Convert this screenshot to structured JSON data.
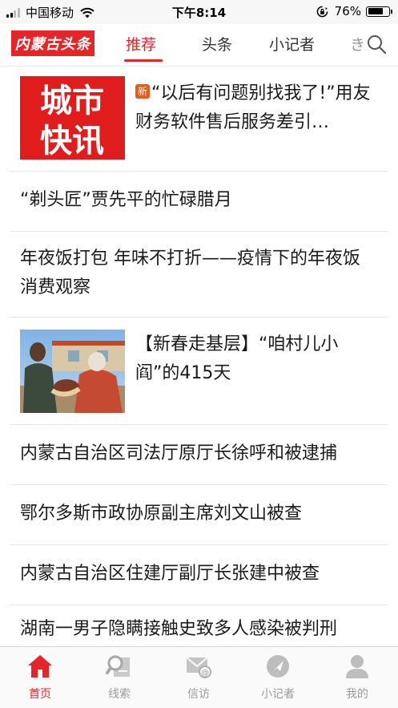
{
  "status_bar": {
    "carrier": "中国移动",
    "time": "下午8:14",
    "battery_percent": "76%",
    "battery_level": 0.76
  },
  "nav": {
    "logo_text": "内蒙古头条",
    "tabs": [
      {
        "label": "推荐",
        "active": true
      },
      {
        "label": "头条",
        "active": false
      },
      {
        "label": "小记者",
        "active": false
      },
      {
        "label": "き",
        "active": false
      }
    ],
    "accent_color": "#e4262a"
  },
  "articles": [
    {
      "badge": "新",
      "title": "“以后有问题别找我了!”用友财务软件售后服务差引…",
      "thumbnail_text": [
        "城市",
        "快讯"
      ]
    },
    {
      "title": "“剃头匠”贾先平的忙碌腊月"
    },
    {
      "title": "年夜饭打包 年味不打折——疫情下的年夜饭消费观察"
    },
    {
      "title": "【新春走基层】“咱村儿小阎”的415天"
    },
    {
      "title": "内蒙古自治区司法厅原厅长徐呼和被逮捕"
    },
    {
      "title": "鄂尔多斯市政协原副主席刘文山被查"
    },
    {
      "title": "内蒙古自治区住建厅副厅长张建中被查"
    },
    {
      "title": "湖南一男子隐瞒接触史致多人感染被判刑"
    }
  ],
  "tab_bar": {
    "items": [
      {
        "label": "首页",
        "icon": "home-icon",
        "active": true
      },
      {
        "label": "线索",
        "icon": "clue-icon",
        "active": false
      },
      {
        "label": "信访",
        "icon": "letter-icon",
        "active": false
      },
      {
        "label": "小记者",
        "icon": "reporter-icon",
        "active": false
      },
      {
        "label": "我的",
        "icon": "profile-icon",
        "active": false
      }
    ]
  }
}
